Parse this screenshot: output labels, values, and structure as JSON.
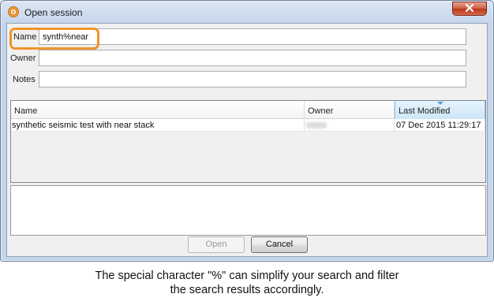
{
  "window": {
    "title": "Open session",
    "app_icon": "hexagon-app-icon",
    "close_icon": "close-x-icon"
  },
  "filters": {
    "name_label": "Name",
    "name_value": "synth%near",
    "owner_label": "Owner",
    "owner_value": "",
    "notes_label": "Notes",
    "notes_value": ""
  },
  "table": {
    "columns": [
      "Name",
      "Owner",
      "Last Modified"
    ],
    "sorted_column": "Last Modified",
    "rows": [
      {
        "name": "synthetic seismic test with near stack",
        "owner": "",
        "last_modified": "07 Dec 2015 11:29:17"
      }
    ]
  },
  "buttons": {
    "open_label": "Open",
    "open_enabled": false,
    "cancel_label": "Cancel"
  },
  "caption": {
    "line1": "The special character \"%\" can simplify your search and filter",
    "line2": "the search results accordingly."
  },
  "colors": {
    "highlight": "#f0932b",
    "close_button": "#c9462a",
    "sorted_header": "#cde6f7"
  }
}
